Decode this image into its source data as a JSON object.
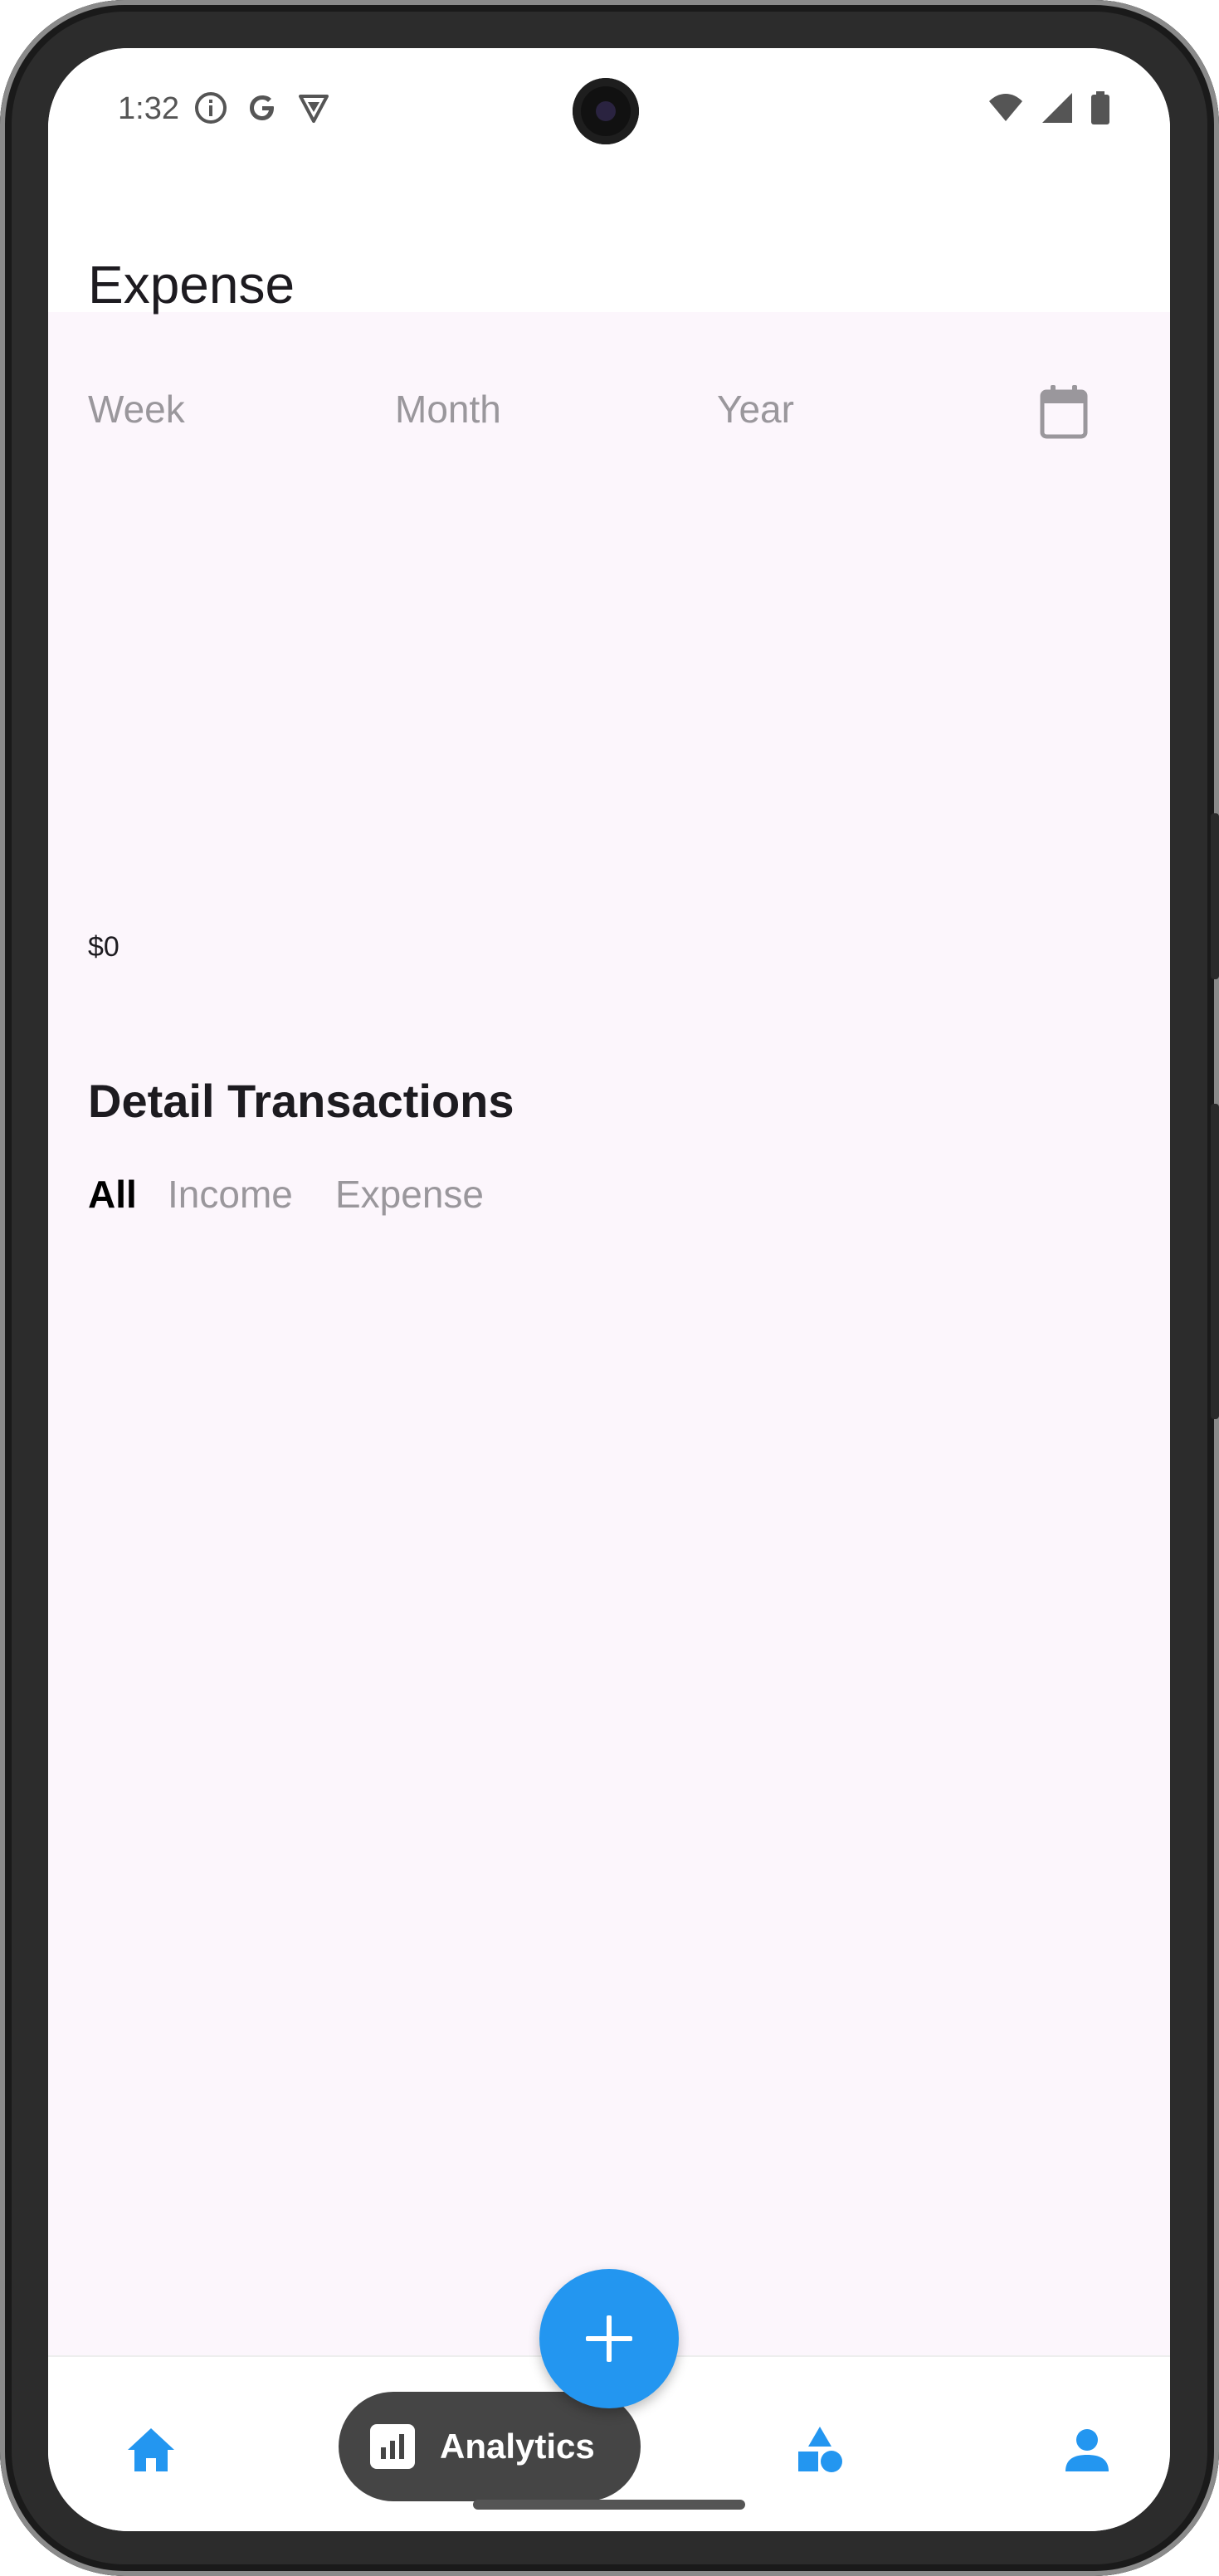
{
  "status_bar": {
    "time": "1:32",
    "left_icons": [
      "info-icon",
      "google-icon",
      "vpn-icon"
    ],
    "right_icons": [
      "wifi-icon",
      "signal-icon",
      "battery-icon"
    ]
  },
  "app_bar": {
    "title": "Expense"
  },
  "period_tabs": [
    {
      "label": "Week"
    },
    {
      "label": "Month"
    },
    {
      "label": "Year"
    }
  ],
  "chart": {
    "y_label": "$0"
  },
  "transactions": {
    "title": "Detail Transactions",
    "filters": [
      {
        "label": "All",
        "active": true
      },
      {
        "label": "Income",
        "active": false
      },
      {
        "label": "Expense",
        "active": false
      }
    ]
  },
  "bottom_nav": {
    "items": [
      {
        "icon": "home-icon"
      },
      {
        "icon": "analytics-icon",
        "label": "Analytics",
        "selected": true
      },
      {
        "icon": "categories-icon"
      },
      {
        "icon": "profile-icon"
      }
    ]
  },
  "fab": {
    "icon": "add-icon"
  },
  "colors": {
    "accent": "#2396f0",
    "background": "#fcf6fc",
    "muted_text": "#9a979c",
    "pill": "#454545"
  }
}
